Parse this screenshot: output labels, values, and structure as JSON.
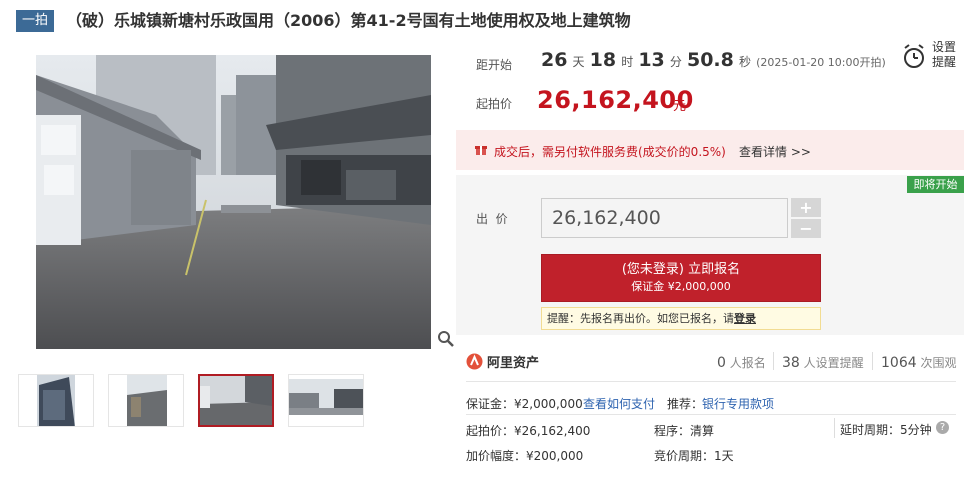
{
  "header": {
    "badge": "一拍",
    "title": "（破）乐城镇新塘村乐政国用（2006）第41-2号国有土地使用权及地上建筑物"
  },
  "countdown": {
    "label": "距开始",
    "days": "26",
    "days_unit": "天",
    "hours": "18",
    "hours_unit": "时",
    "minutes": "13",
    "minutes_unit": "分",
    "seconds": "50.8",
    "seconds_unit": "秒",
    "start_note": "(2025-01-20 10:00开拍)"
  },
  "alarm": {
    "line1": "设置",
    "line2": "提醒",
    "icon": "alarm-clock-icon"
  },
  "start_price": {
    "label": "起拍价",
    "value": "26,162,400",
    "unit": "元"
  },
  "notice": {
    "text": "成交后，需另付软件服务费(成交价的0.5%)",
    "link": "查看详情 >>"
  },
  "bid": {
    "soon_tag": "即将开始",
    "label": "出  价",
    "value": "26,162,400",
    "plus": "+",
    "minus": "−",
    "signup_line1": "(您未登录) 立即报名",
    "signup_line2": "保证金 ¥2,000,000",
    "tip_text": "提醒：先报名再出价。如您已报名，请",
    "tip_link": "登录"
  },
  "stats": {
    "logo": "阿里资产",
    "signups": "0",
    "signups_label": "人报名",
    "reminders": "38",
    "reminders_label": "人设置提醒",
    "views": "1064",
    "views_label": "次围观"
  },
  "details": {
    "deposit": "保证金：¥2,000,000",
    "pay_link": "查看如何支付",
    "recommend_label": "推荐：",
    "recommend_link": "银行专用款项",
    "start_price": "起拍价：¥26,162,400",
    "procedure": "程序：清算",
    "delay": "延时周期：5分钟",
    "increment": "加价幅度：¥200,000",
    "bid_period": "竞价周期：1天"
  },
  "colors": {
    "accent": "#c4141e",
    "badge": "#3c6a96",
    "link": "#2f64b0",
    "soon": "#3aa14b"
  }
}
